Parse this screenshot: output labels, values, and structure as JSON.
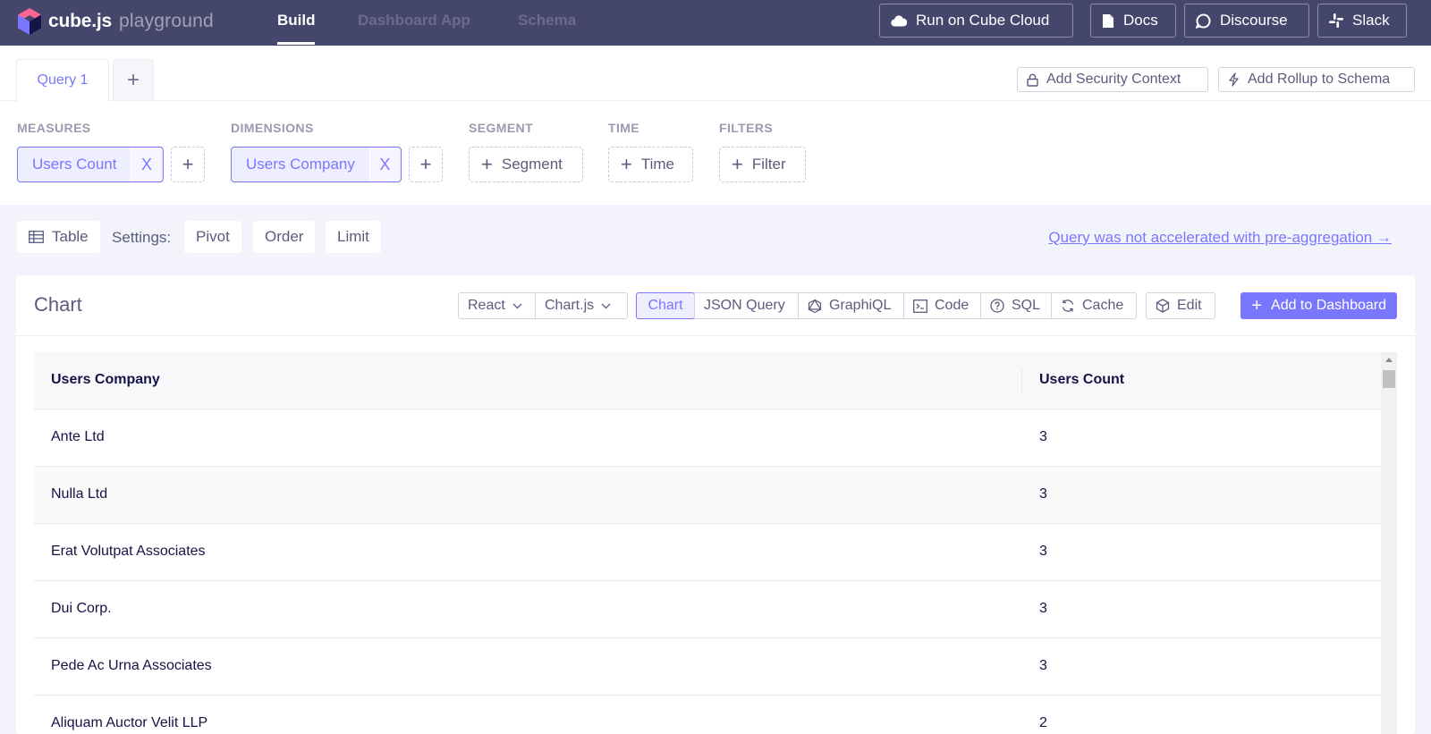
{
  "app": {
    "logo_text": "cube.js",
    "logo_sub": "playground",
    "nav": [
      "Build",
      "Dashboard App",
      "Schema"
    ],
    "buttons": {
      "cloud": "Run on Cube Cloud",
      "docs": "Docs",
      "discourse": "Discourse",
      "slack": "Slack"
    }
  },
  "query_tabs": {
    "active": "Query 1",
    "add": "+"
  },
  "header_actions": {
    "security": "Add Security Context",
    "rollup": "Add Rollup to Schema"
  },
  "sections": {
    "measures": {
      "label": "MEASURES",
      "chip": "Users Count"
    },
    "dimensions": {
      "label": "DIMENSIONS",
      "chip": "Users Company"
    },
    "segment": {
      "label": "SEGMENT",
      "button": "Segment"
    },
    "time": {
      "label": "TIME",
      "button": "Time"
    },
    "filters": {
      "label": "FILTERS",
      "button": "Filter"
    },
    "remove_glyph": "X",
    "plus_glyph": "+"
  },
  "settings": {
    "viz": "Table",
    "label": "Settings:",
    "pivot": "Pivot",
    "order": "Order",
    "limit": "Limit",
    "preagg_link": "Query was not accelerated with pre-aggregation →"
  },
  "chart_card": {
    "title": "Chart",
    "framework": "React",
    "library": "Chart.js",
    "tabs": [
      "Chart",
      "JSON Query",
      "GraphiQL",
      "Code",
      "SQL",
      "Cache"
    ],
    "edit": "Edit",
    "add_to_dashboard": "Add to Dashboard"
  },
  "table": {
    "columns": [
      "Users Company",
      "Users Count"
    ],
    "rows": [
      [
        "Ante Ltd",
        "3"
      ],
      [
        "Nulla Ltd",
        "3"
      ],
      [
        "Erat Volutpat Associates",
        "3"
      ],
      [
        "Dui Corp.",
        "3"
      ],
      [
        "Pede Ac Urna Associates",
        "3"
      ],
      [
        "Aliquam Auctor Velit LLP",
        "2"
      ]
    ]
  },
  "colors": {
    "topbar": "#45466b",
    "accent": "#7a77ff",
    "text": "#141446",
    "muted": "#5b5c7d"
  },
  "icons": [
    "cube-logo-icon",
    "cloud-icon",
    "doc-icon",
    "chat-icon",
    "slack-icon",
    "lock-icon",
    "bolt-icon",
    "table-icon",
    "chevron-down-icon",
    "graphql-icon",
    "terminal-icon",
    "question-icon",
    "refresh-icon",
    "box-icon",
    "plus-icon",
    "close-icon"
  ]
}
